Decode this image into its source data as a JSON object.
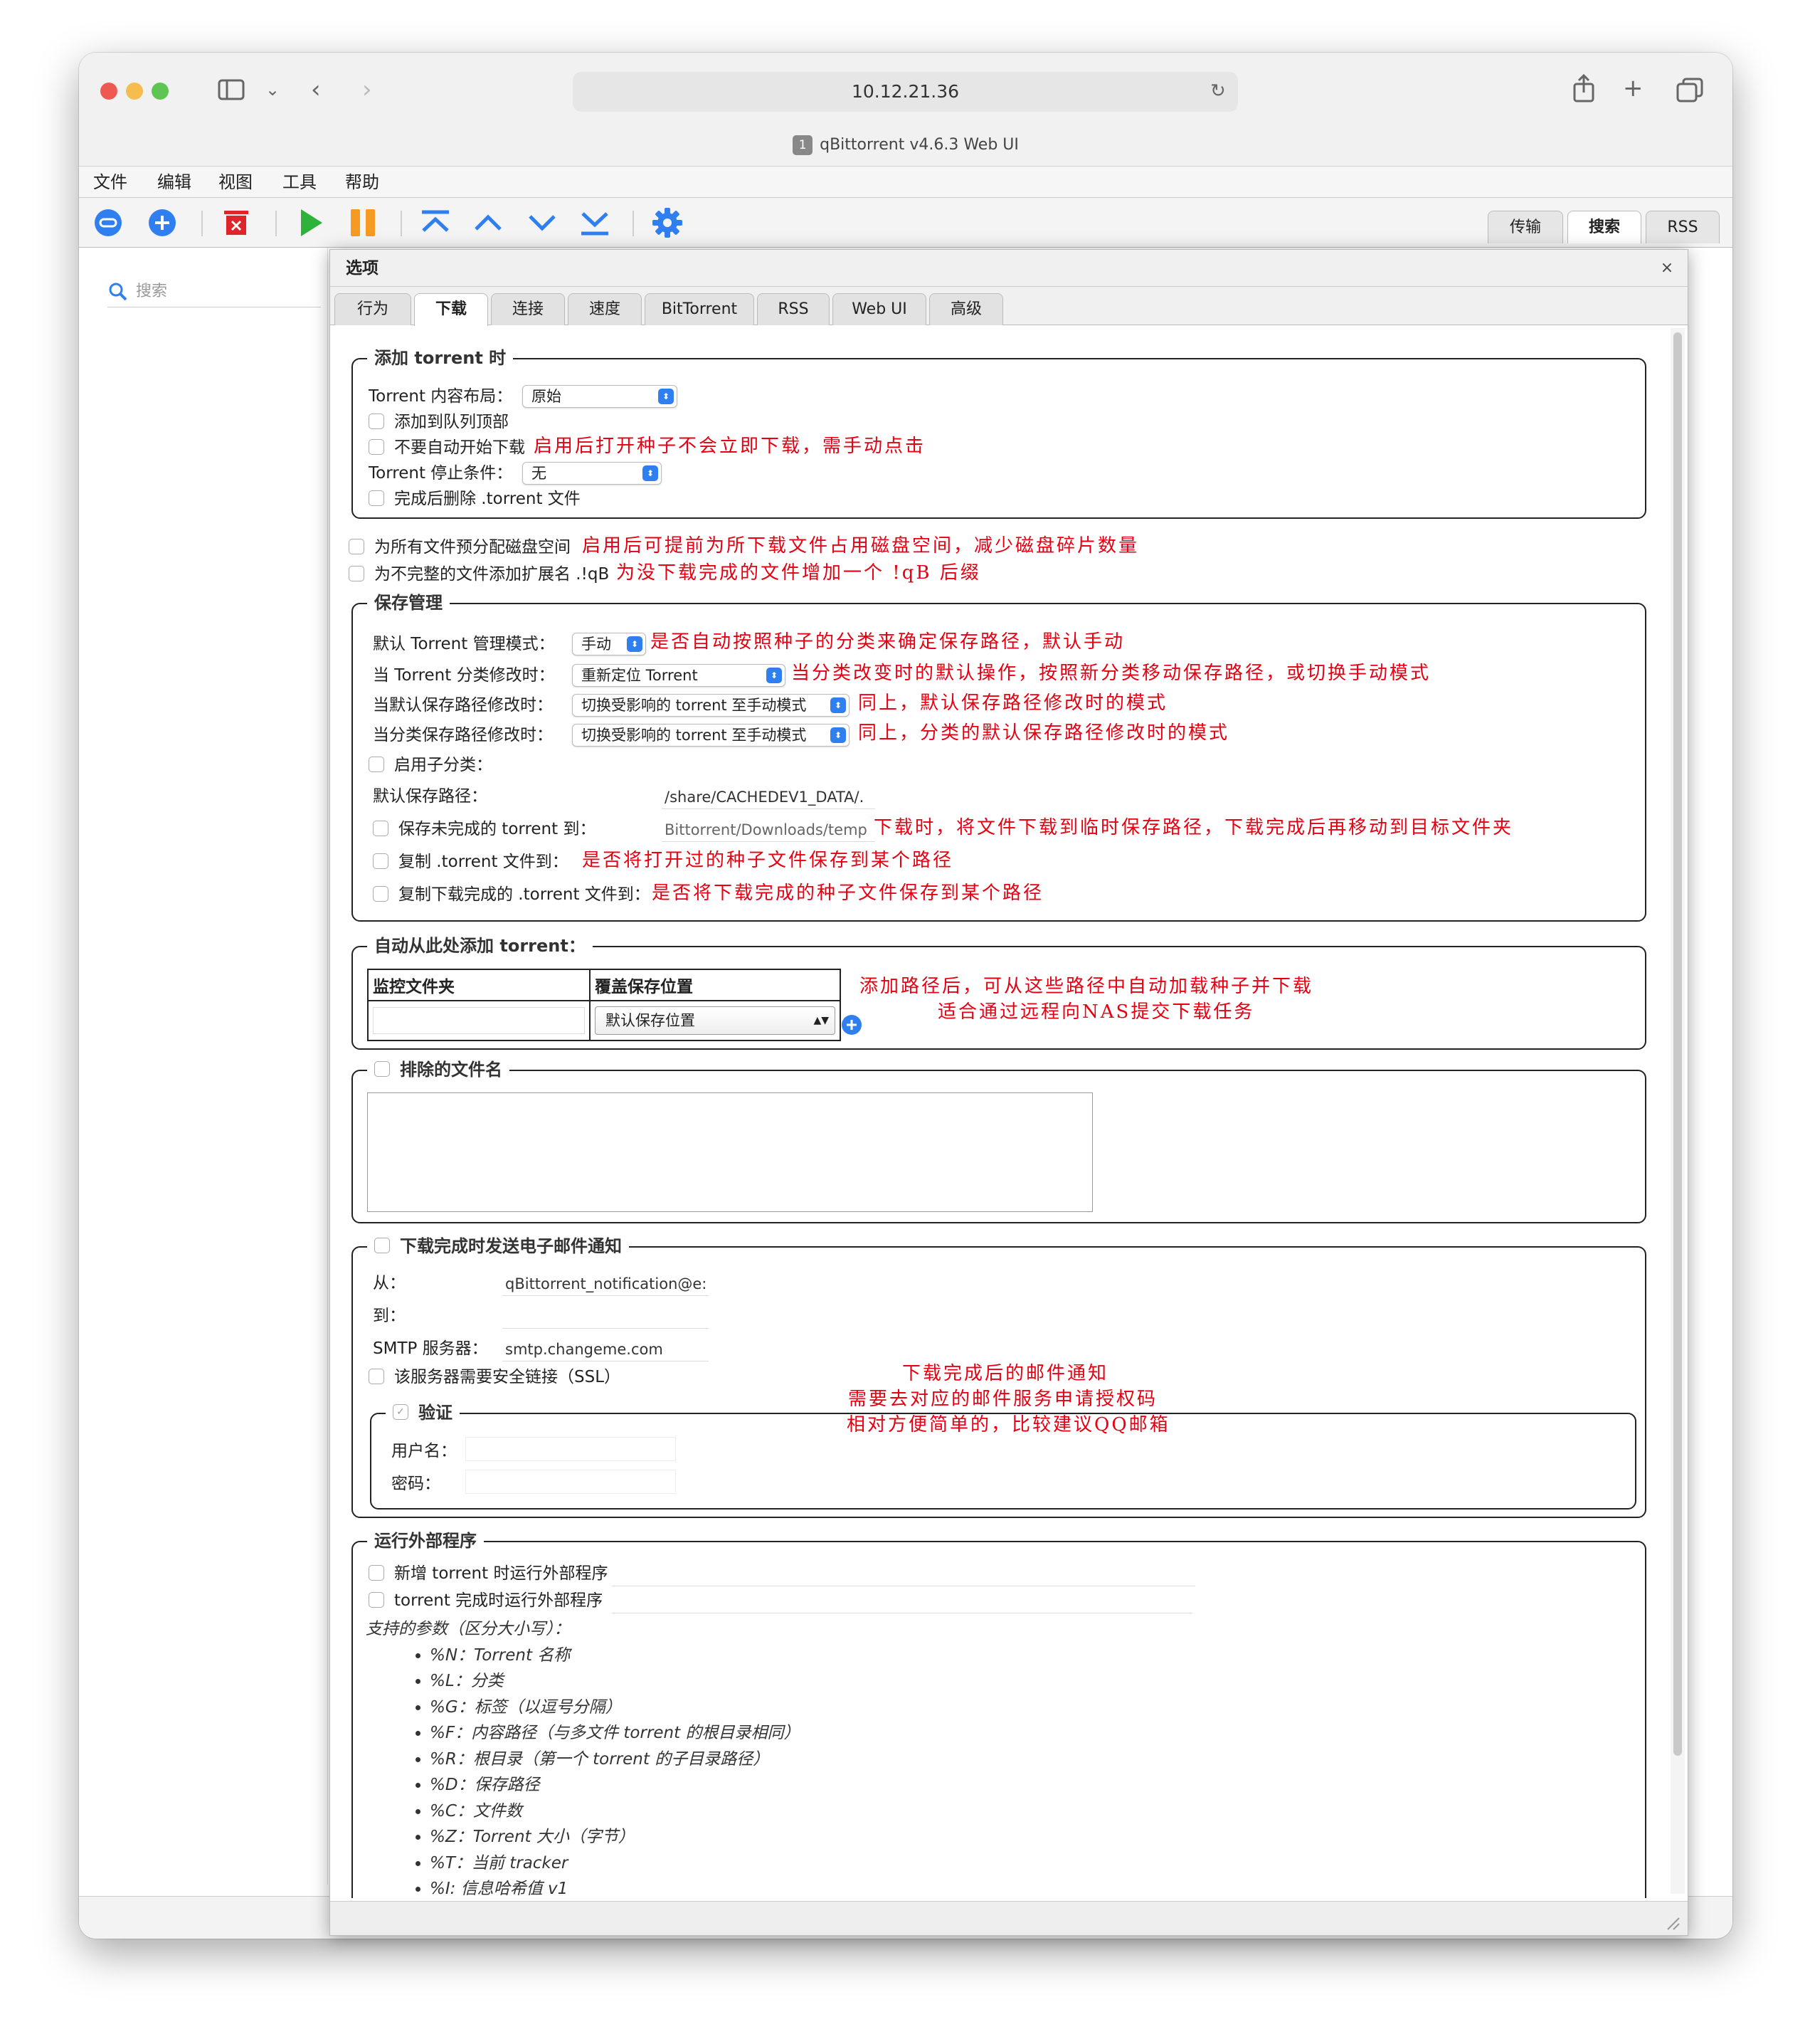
{
  "browser": {
    "url": "10.12.21.36",
    "tab_badge": "1",
    "tab_title": "qBittorrent v4.6.3 Web UI"
  },
  "menu": [
    "文件",
    "编辑",
    "视图",
    "工具",
    "帮助"
  ],
  "right_tabs": [
    "传输",
    "搜索",
    "RSS"
  ],
  "left": {
    "search_placeholder": "搜索"
  },
  "dialog": {
    "title": "选项",
    "tabs": [
      "行为",
      "下载",
      "连接",
      "速度",
      "BitTorrent",
      "RSS",
      "Web UI",
      "高级"
    ],
    "active_tab": "下载",
    "add_torrent": {
      "legend": "添加 torrent 时",
      "layout_label": "Torrent 内容布局：",
      "layout_value": "原始",
      "add_top": "添加到队列顶部",
      "no_autostart": "不要自动开始下载",
      "no_autostart_note": "启用后打开种子不会立即下载，需手动点击",
      "stop_label": "Torrent 停止条件：",
      "stop_value": "无",
      "delete_after": "完成后删除 .torrent 文件"
    },
    "prealloc": "为所有文件预分配磁盘空间",
    "prealloc_note": "启用后可提前为所下载文件占用磁盘空间，减少磁盘碎片数量",
    "qb_ext": "为不完整的文件添加扩展名 .!qB",
    "qb_ext_note": "为没下载完成的文件增加一个 !qB 后缀",
    "save_mgmt": {
      "legend": "保存管理",
      "mode_label": "默认 Torrent 管理模式：",
      "mode_value": "手动",
      "mode_note": "是否自动按照种子的分类来确定保存路径，默认手动",
      "cat_changed_label": "当 Torrent 分类修改时：",
      "cat_changed_value": "重新定位 Torrent",
      "cat_changed_note": "当分类改变时的默认操作，按照新分类移动保存路径，或切换手动模式",
      "default_path_changed_label": "当默认保存路径修改时：",
      "default_path_changed_value": "切换受影响的 torrent 至手动模式",
      "default_path_changed_note": "同上，默认保存路径修改时的模式",
      "cat_path_changed_label": "当分类保存路径修改时：",
      "cat_path_changed_value": "切换受影响的 torrent 至手动模式",
      "cat_path_changed_note": "同上，分类的默认保存路径修改时的模式",
      "subcat": "启用子分类：",
      "default_path_label": "默认保存路径：",
      "default_path_value": "/share/CACHEDEV1_DATA/.",
      "incomplete_label": "保存未完成的 torrent 到：",
      "incomplete_value": "Bittorrent/Downloads/temp",
      "incomplete_note": "下载时，将文件下载到临时保存路径，下载完成后再移动到目标文件夹",
      "copy_torrent": "复制 .torrent 文件到：",
      "copy_torrent_note": "是否将打开过的种子文件保存到某个路径",
      "copy_finished": "复制下载完成的 .torrent 文件到：",
      "copy_finished_note": "是否将下载完成的种子文件保存到某个路径"
    },
    "auto_add": {
      "legend": "自动从此处添加 torrent：",
      "col_watch": "监控文件夹",
      "col_override": "覆盖保存位置",
      "override_value": "默认保存位置",
      "note1": "添加路径后，可从这些路径中自动加载种子并下载",
      "note2": "适合通过远程向NAS提交下载任务"
    },
    "excluded": {
      "legend": "排除的文件名"
    },
    "email": {
      "legend": "下载完成时发送电子邮件通知",
      "from_label": "从：",
      "from_value": "qBittorrent_notification@e:",
      "to_label": "到：",
      "smtp_label": "SMTP 服务器：",
      "smtp_value": "smtp.changeme.com",
      "ssl": "该服务器需要安全链接（SSL）",
      "auth_legend": "验证",
      "user_label": "用户名：",
      "pass_label": "密码：",
      "note1": "下载完成后的邮件通知",
      "note2": "需要去对应的邮件服务申请授权码",
      "note3": "相对方便简单的，比较建议QQ邮箱"
    },
    "external": {
      "legend": "运行外部程序",
      "on_add": "新增 torrent 时运行外部程序",
      "on_finish": "torrent 完成时运行外部程序",
      "params_title": "支持的参数（区分大小写）：",
      "params": [
        "%N：Torrent 名称",
        "%L：分类",
        "%G：标签（以逗号分隔）",
        "%F：内容路径（与多文件 torrent 的根目录相同）",
        "%R：根目录（第一个 torrent 的子目录路径）",
        "%D：保存路径",
        "%C：文件数",
        "%Z：Torrent 大小（字节）",
        "%T：当前 tracker",
        "%I: 信息哈希值 v1"
      ]
    }
  },
  "colors": {
    "annotation": "#e60012",
    "accent": "#2f7ff1",
    "play": "#2db33a",
    "pause": "#f59a23",
    "delete": "#e0252a"
  },
  "icons": [
    "sidebar-icon",
    "back-icon",
    "forward-icon",
    "reload-icon",
    "share-icon",
    "new-tab-icon",
    "tabs-icon",
    "add-link-icon",
    "add-torrent-icon",
    "delete-icon",
    "resume-icon",
    "pause-icon",
    "move-top-icon",
    "move-up-icon",
    "move-down-icon",
    "move-bottom-icon",
    "settings-icon",
    "search-icon",
    "close-icon",
    "add-icon"
  ]
}
